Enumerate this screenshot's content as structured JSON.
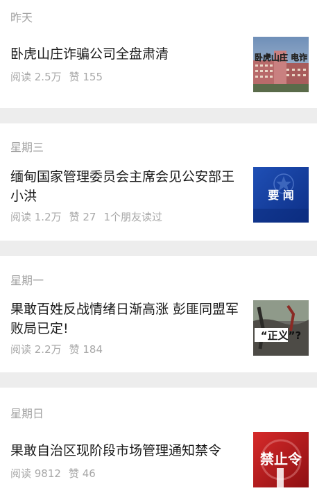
{
  "sections": [
    {
      "day": "昨天",
      "title": "卧虎山庄诈骗公司全盘肃清",
      "reads": "阅读 2.5万",
      "likes": "赞 155",
      "friends": "",
      "thumb_text": "卧虎山庄 电诈",
      "thumb_icon": "building-photo"
    },
    {
      "day": "星期三",
      "title": "缅甸国家管理委员会主席会见公安部王小洪",
      "reads": "阅读 1.2万",
      "likes": "赞 27",
      "friends": "1个朋友读过",
      "thumb_text": "要  闻",
      "thumb_icon": "police-emblem"
    },
    {
      "day": "星期一",
      "title": "果敢百姓反战情绪日渐高涨 彭匪同盟军败局已定!",
      "reads": "阅读 2.2万",
      "likes": "赞 184",
      "friends": "",
      "thumb_text": "“正义”?",
      "thumb_icon": "war-photo"
    },
    {
      "day": "星期日",
      "title": "果敢自治区现阶段市场管理通知禁令",
      "reads": "阅读 9812",
      "likes": "赞 46",
      "friends": "",
      "thumb_text": "禁止令",
      "thumb_icon": "ban-sign"
    }
  ],
  "colors": {
    "background": "#ededed",
    "card": "#ffffff",
    "title": "#1a1a1a",
    "meta": "#a8a8a8"
  }
}
